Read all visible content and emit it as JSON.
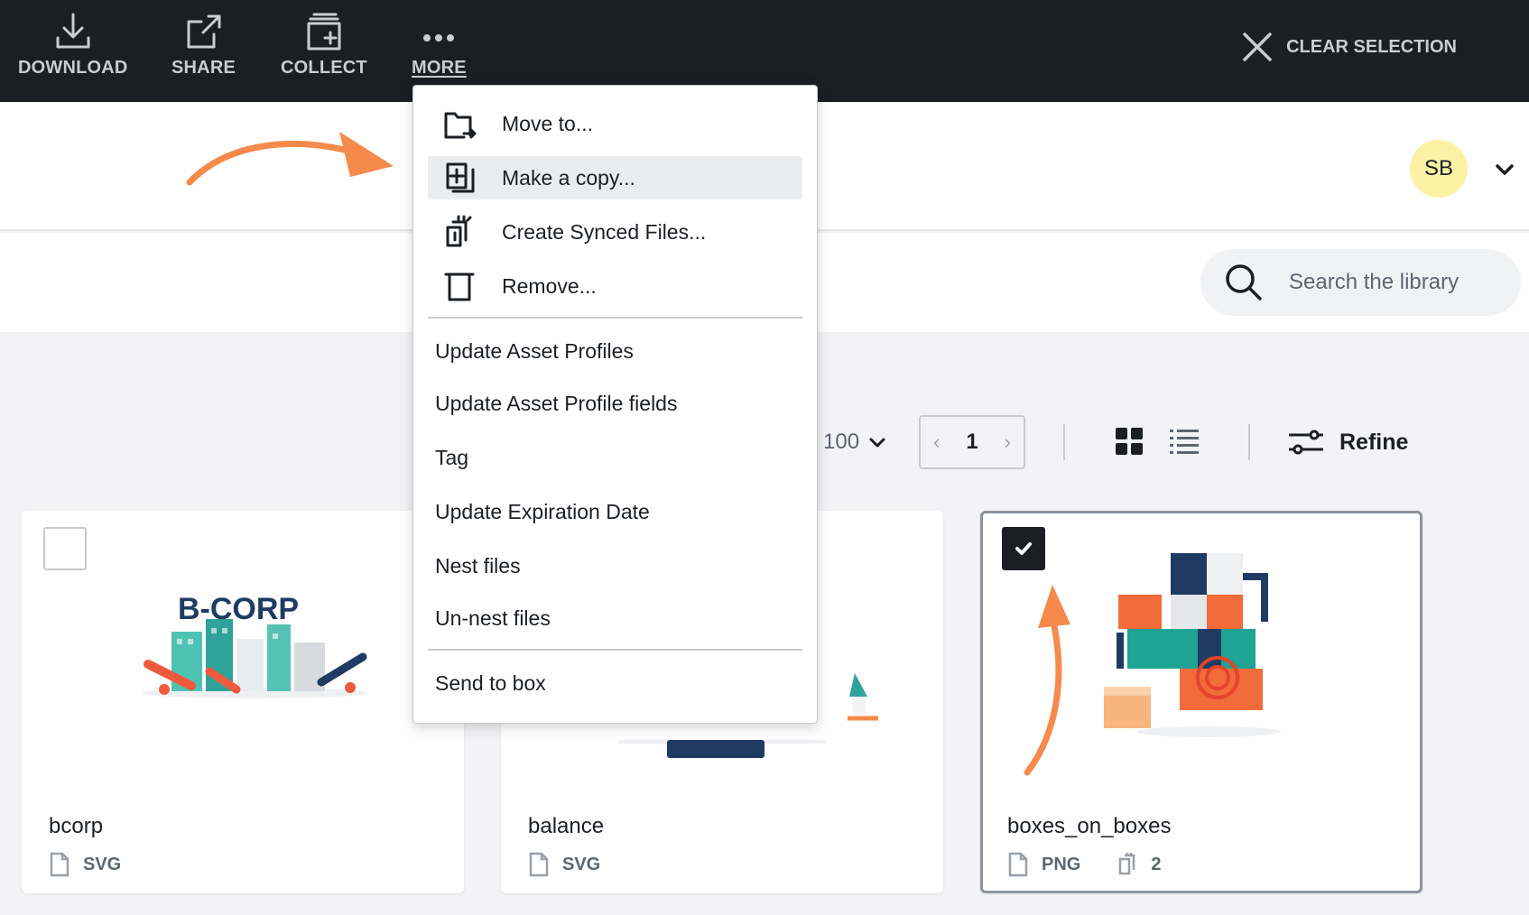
{
  "toolbar": {
    "download": "DOWNLOAD",
    "share": "SHARE",
    "collect": "COLLECT",
    "more": "MORE",
    "clear_selection": "CLEAR SELECTION"
  },
  "user": {
    "initials": "SB"
  },
  "search": {
    "placeholder": "Search the library"
  },
  "controls": {
    "per_page": "100",
    "page": "1",
    "refine": "Refine"
  },
  "menu": {
    "items": [
      {
        "label": "Move to...",
        "icon": "move-folder-icon"
      },
      {
        "label": "Make a copy...",
        "icon": "copy-icon",
        "highlighted": true
      },
      {
        "label": "Create Synced Files...",
        "icon": "synced-files-icon"
      },
      {
        "label": "Remove...",
        "icon": "trash-icon"
      },
      {
        "label": "Update Asset Profiles"
      },
      {
        "label": "Update Asset Profile fields"
      },
      {
        "label": "Tag"
      },
      {
        "label": "Update Expiration Date"
      },
      {
        "label": "Nest files"
      },
      {
        "label": "Un-nest files"
      },
      {
        "label": "Send to box"
      }
    ]
  },
  "assets": [
    {
      "name": "bcorp",
      "type": "SVG",
      "selected": false,
      "logo_text": "B-CORP"
    },
    {
      "name": "balance",
      "type": "SVG",
      "selected": false
    },
    {
      "name": "boxes_on_boxes",
      "type": "PNG",
      "selected": true,
      "synced_count": "2"
    }
  ],
  "colors": {
    "toolbar_bg": "#1b1f24",
    "accent_arrow": "#f58a4c",
    "avatar_bg": "#fdf1a6"
  }
}
